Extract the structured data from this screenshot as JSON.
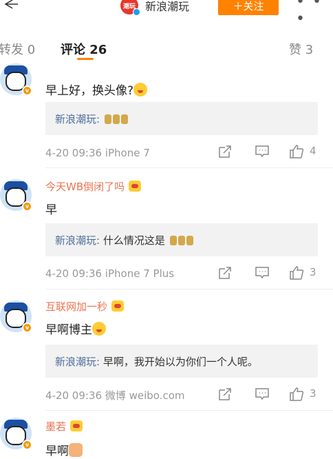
{
  "header": {
    "back_icon": "back-arrow-icon",
    "logo_text": "潮玩",
    "title": "新浪潮玩",
    "follow_label": "＋关注",
    "more_label": "• • •",
    "accent": "#ff8200"
  },
  "tabs": {
    "repost": "转发 0",
    "comments": "评论 26",
    "likes": "赞 3"
  },
  "comments": [
    {
      "username": "",
      "text": "早上好，换头像?",
      "reply_author": "新浪潮玩:",
      "reply_text": "",
      "meta": "4-20 09:36 iPhone 7",
      "likes": "4"
    },
    {
      "username": "今天WB倒闭了吗",
      "text": "早",
      "reply_author": "新浪潮玩:",
      "reply_text": " 什么情况这是",
      "meta": "4-20 09:36 iPhone 7 Plus",
      "likes": "3"
    },
    {
      "username": "互联网加一秒",
      "text": "早啊博主",
      "reply_author": "新浪潮玩:",
      "reply_text": " 早啊，我开始以为你们一个人呢。",
      "meta": "4-20 09:36 微博 weibo.com",
      "likes": "3"
    },
    {
      "username": "墨若",
      "text": "早啊"
    }
  ]
}
